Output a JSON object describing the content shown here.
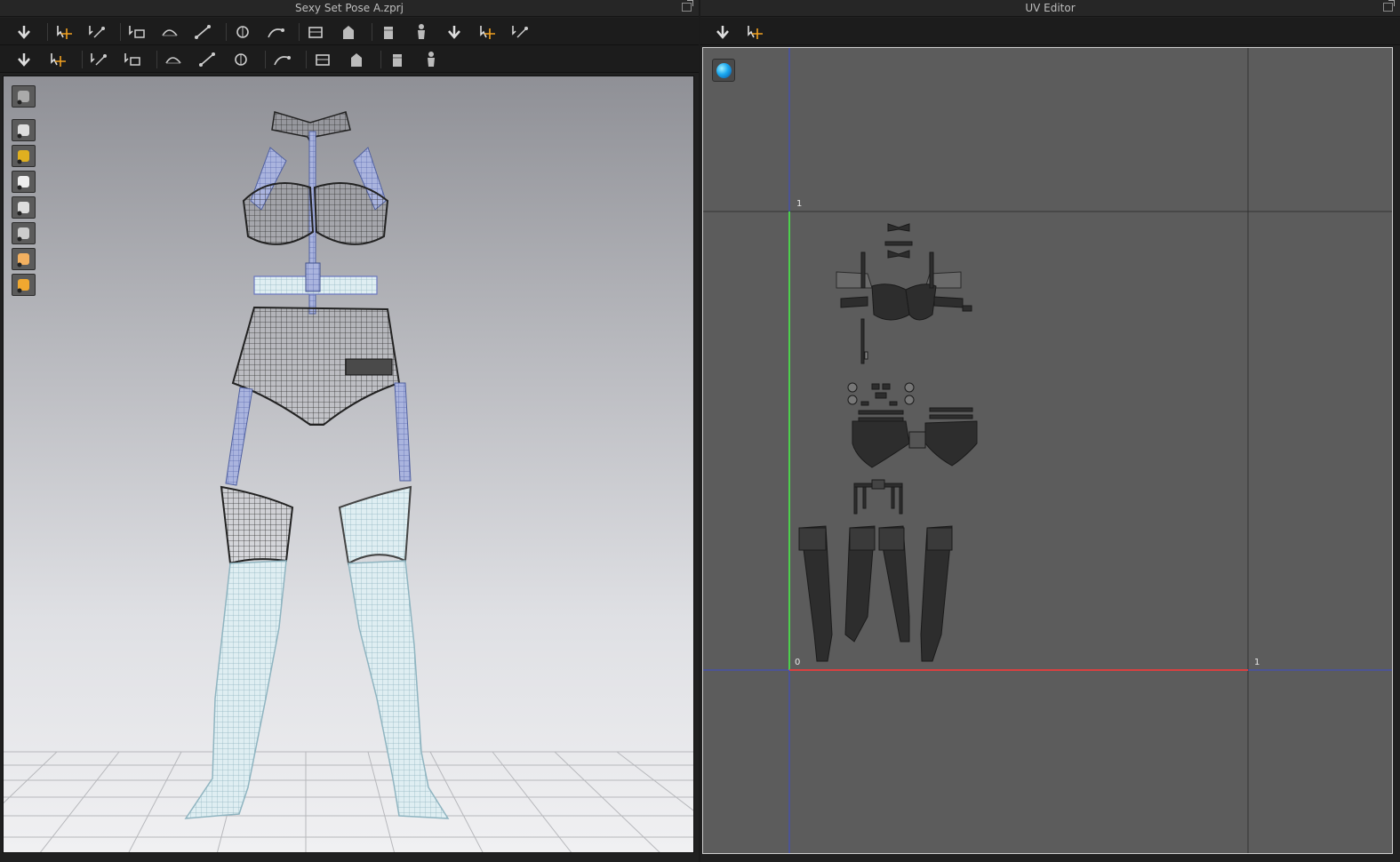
{
  "left_window": {
    "title": "Sexy Set Pose A.zprj"
  },
  "right_window": {
    "title": "UV Editor"
  },
  "toolbar_row1": [
    "move-down-icon",
    "transform-select-icon",
    "edit-curve-icon",
    "reset-pattern-icon",
    "fold-icon",
    "unfold-icon",
    "segment-line-icon",
    "bezier-icon",
    "tack-icon",
    "tack-on-avatar-icon",
    "pin-icon",
    "symmetry-icon",
    "fold-arrange-icon",
    "avatar-pose-icon",
    "avatar-arrange-icon"
  ],
  "toolbar_row2": [
    "sewing-tool-icon",
    "multi-sewing-icon",
    "seamline-icon",
    "free-sewing-icon",
    "gizmo-icon",
    "button-icon",
    "buttonhole-icon",
    "lock-icon",
    "zipper-icon",
    "stitch-icon",
    "fold-line-icon",
    "measure-icon"
  ],
  "viewport_side": [
    "render-icon",
    "avatar-visibility-icon",
    "points-icon",
    "joint-icon",
    "texture-mode-icon",
    "shaded-icon",
    "skin-icon",
    "avatar-color-icon"
  ],
  "uv_editor": {
    "toolbar": [
      "capture-image-icon",
      "capture-all-icon"
    ],
    "axis_labels": {
      "v_top": "1",
      "origin": "0",
      "u_right": "1"
    }
  },
  "colors": {
    "u_axis": "#d94040",
    "v_axis": "#4ccf4c",
    "grid_blue": "#3c4ccc",
    "accent_globe": "#1aa8f0"
  }
}
